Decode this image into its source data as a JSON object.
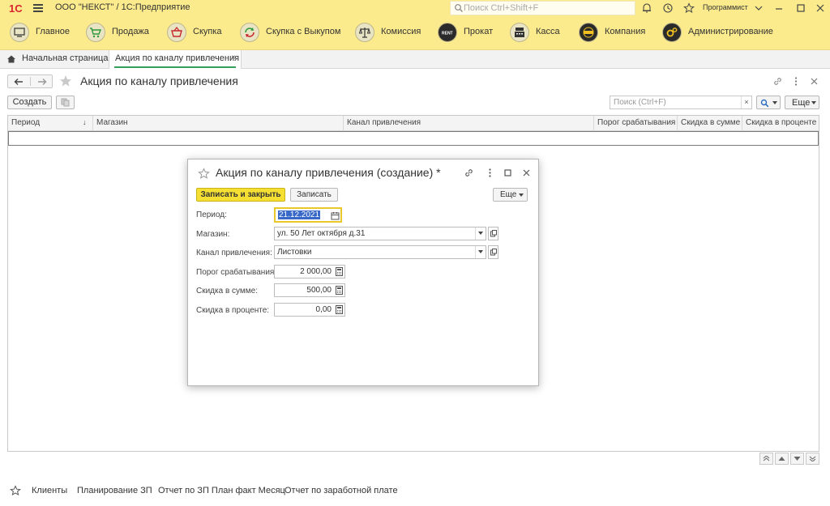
{
  "titlebar": {
    "logo_text": "1С",
    "org": "ООО \"НЕКСТ\"",
    "separator": "/",
    "app": "1С:Предприятие",
    "search_placeholder": "Поиск Ctrl+Shift+F",
    "user": "Программист"
  },
  "sections": [
    {
      "label": "Главное",
      "icon": "home-icon"
    },
    {
      "label": "Продажа",
      "icon": "cart-icon"
    },
    {
      "label": "Скупка",
      "icon": "basket-icon"
    },
    {
      "label": "Скупка с Выкупом",
      "icon": "cycle-arrows-icon"
    },
    {
      "label": "Комиссия",
      "icon": "scales-icon"
    },
    {
      "label": "Прокат",
      "icon": "rent-icon"
    },
    {
      "label": "Касса",
      "icon": "cash-register-icon"
    },
    {
      "label": "Компания",
      "icon": "company-icon"
    },
    {
      "label": "Администрирование",
      "icon": "gears-icon"
    }
  ],
  "tabs": {
    "home": "Начальная страница",
    "active": "Акция по каналу привлечения",
    "close": "×"
  },
  "list": {
    "title": "Акция по каналу привлечения",
    "create_label": "Создать",
    "search_placeholder": "Поиск (Ctrl+F)",
    "clear": "×",
    "more_label": "Еще",
    "columns": [
      "Период",
      "Магазин",
      "Канал привлечения",
      "Порог срабатывания",
      "Скидка в сумме",
      "Скидка в проценте"
    ],
    "sort_marker": "↓"
  },
  "modal": {
    "title": "Акция по каналу привлечения (создание) *",
    "save_close_label": "Записать и закрыть",
    "save_label": "Записать",
    "more_label": "Еще",
    "fields": {
      "period": {
        "label": "Период:",
        "value": "21.12.2021"
      },
      "store": {
        "label": "Магазин:",
        "value": "ул. 50 Лет октября д.31"
      },
      "channel": {
        "label": "Канал привлечения:",
        "value": "Листовки"
      },
      "threshold": {
        "label": "Порог срабатывания:",
        "value": "2 000,00"
      },
      "discount_sum": {
        "label": "Скидка в сумме:",
        "value": "500,00"
      },
      "discount_pct": {
        "label": "Скидка в проценте:",
        "value": "0,00"
      }
    }
  },
  "footer": {
    "links": [
      "Клиенты",
      "Планирование ЗП",
      "Отчет по ЗП План факт Месяц",
      "Отчет по заработной плате"
    ]
  },
  "colors": {
    "bar": "#fbeb8c",
    "primary_button": "#f5df33",
    "active_tab_line": "#35a05a",
    "selection": "#3868c8"
  }
}
